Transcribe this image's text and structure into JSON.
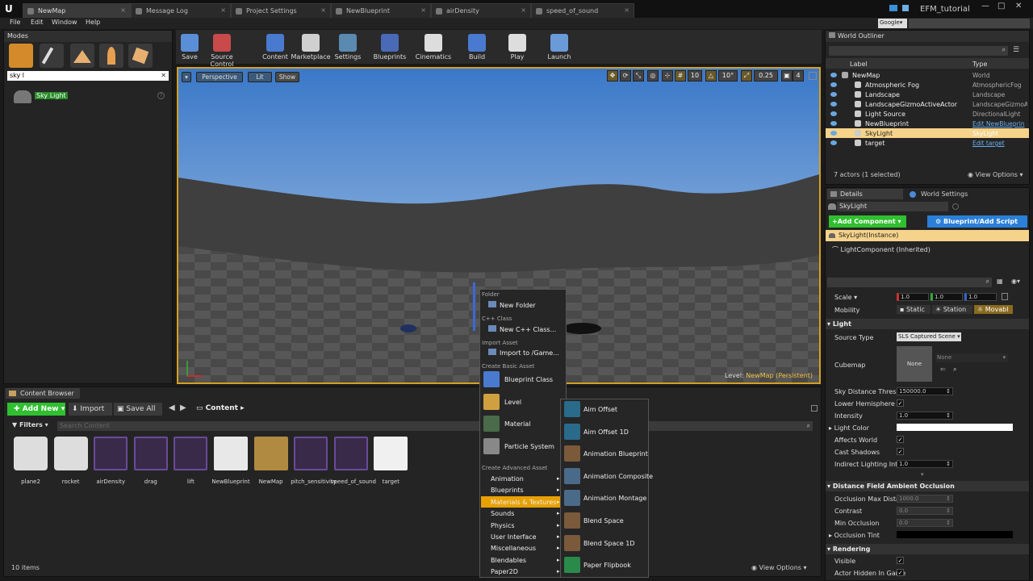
{
  "tabs": [
    "NewMap",
    "Message Log",
    "Project Settings",
    "NewBlueprint",
    "airDensity",
    "speed_of_sound"
  ],
  "title_right": {
    "project": "EFM_tutorial",
    "search_label": "Google"
  },
  "menus": [
    "File",
    "Edit",
    "Window",
    "Help"
  ],
  "modes": {
    "title": "Modes",
    "search_value": "sky l",
    "result": "Sky Light"
  },
  "toolbar": [
    "Save",
    "Source Control",
    "Content",
    "Marketplace",
    "Settings",
    "Blueprints",
    "Cinematics",
    "Build",
    "Play",
    "Launch"
  ],
  "viewport": {
    "perspective": "Perspective",
    "lit": "Lit",
    "show": "Show",
    "grid_snap": "10",
    "rot_snap": "10°",
    "scale_snap": "0.25",
    "cam_speed": "4",
    "level_label": "Level:",
    "level_name": "NewMap (Persistent)"
  },
  "context_menu": {
    "sec_folder": "Folder",
    "new_folder": "New Folder",
    "sec_cpp": "C++ Class",
    "new_cpp": "New C++ Class...",
    "sec_import": "Import Asset",
    "import": "Import to /Game...",
    "sec_basic": "Create Basic Asset",
    "basic": [
      "Blueprint Class",
      "Level",
      "Material",
      "Particle System"
    ],
    "sec_advanced": "Create Advanced Asset",
    "advanced": [
      "Animation",
      "Blueprints",
      "Materials & Textures",
      "Sounds",
      "Physics",
      "User Interface",
      "Miscellaneous",
      "Blendables",
      "Paper2D"
    ]
  },
  "submenu": [
    "Aim Offset",
    "Aim Offset 1D",
    "Animation Blueprint",
    "Animation Composite",
    "Animation Montage",
    "Blend Space",
    "Blend Space 1D",
    "Paper Flipbook"
  ],
  "outliner": {
    "title": "World Outliner",
    "col_label": "Label",
    "col_type": "Type",
    "rows": [
      {
        "label": "NewMap",
        "type": "World"
      },
      {
        "label": "Atmospheric Fog",
        "type": "AtmosphericFog"
      },
      {
        "label": "Landscape",
        "type": "Landscape"
      },
      {
        "label": "LandscapeGizmoActiveActor",
        "type": "LandscapeGizmoA"
      },
      {
        "label": "Light Source",
        "type": "DirectionalLight"
      },
      {
        "label": "NewBlueprint",
        "type": "Edit NewBlueprin"
      },
      {
        "label": "SkyLight",
        "type": "SkyLight"
      },
      {
        "label": "target",
        "type": "Edit target"
      }
    ],
    "footer": "7 actors (1 selected)",
    "view_options": "View Options"
  },
  "details": {
    "tab_details": "Details",
    "tab_world": "World Settings",
    "name": "SkyLight",
    "add_component": "+Add Component",
    "bp_script": "Blueprint/Add Script",
    "instance": "SkyLight(Instance)",
    "component": "LightComponent (Inherited)",
    "scale_label": "Scale",
    "scale": [
      "1.0",
      "1.0",
      "1.0"
    ],
    "mobility_label": "Mobility",
    "mobility": [
      "Static",
      "Station",
      "Movabl"
    ],
    "sec_light": "Light",
    "source_type_label": "Source Type",
    "source_type": "SLS Captured Scene",
    "cubemap_label": "Cubemap",
    "cubemap_none": "None",
    "cubemap_select": "None",
    "sky_dist_label": "Sky Distance Thresho",
    "sky_dist": "150000.0",
    "lower_hemi_label": "Lower Hemisphere Is",
    "intensity_label": "Intensity",
    "intensity": "1.0",
    "light_color_label": "Light Color",
    "affects_world_label": "Affects World",
    "cast_shadows_label": "Cast Shadows",
    "indirect_label": "Indirect Lighting Inten",
    "indirect": "1.0",
    "sec_dfao": "Distance Field Ambient Occlusion",
    "occ_max_label": "Occlusion Max Distan",
    "occ_max": "1000.0",
    "contrast_label": "Contrast",
    "contrast": "0.0",
    "min_occ_label": "Min Occlusion",
    "min_occ": "0.0",
    "occ_tint_label": "Occlusion Tint",
    "sec_rendering": "Rendering",
    "visible_label": "Visible",
    "hidden_label": "Actor Hidden In Game"
  },
  "content_browser": {
    "title": "Content Browser",
    "add_new": "Add New",
    "import": "Import",
    "save_all": "Save All",
    "path": "Content",
    "filters": "Filters",
    "search_placeholder": "Search Content",
    "assets": [
      "plane2",
      "rocket",
      "airDensity",
      "drag",
      "lift",
      "NewBlueprint",
      "NewMap",
      "pitch_sensitivity",
      "speed_of_sound",
      "target"
    ],
    "count": "10 items",
    "view_options": "View Options"
  },
  "colors": {
    "accent": "#f0a000",
    "selection": "#f5d38a",
    "blue": "#2a7fd8",
    "green": "#3cb83c"
  }
}
